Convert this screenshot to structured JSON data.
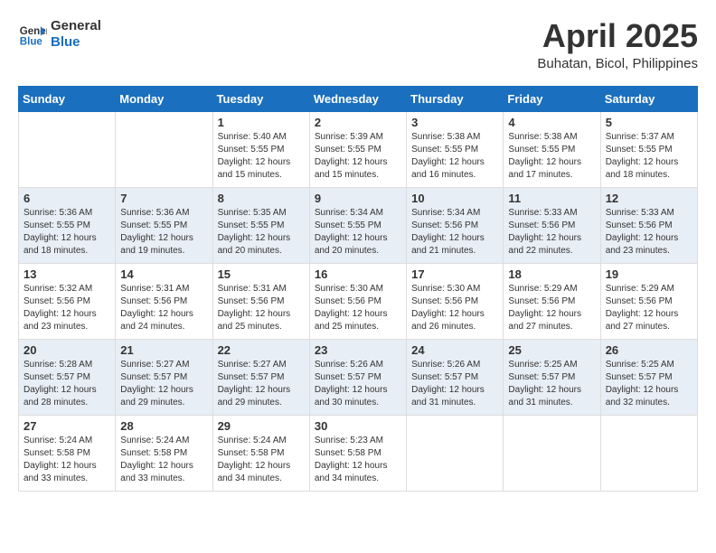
{
  "header": {
    "logo_line1": "General",
    "logo_line2": "Blue",
    "month_title": "April 2025",
    "location": "Buhatan, Bicol, Philippines"
  },
  "days_of_week": [
    "Sunday",
    "Monday",
    "Tuesday",
    "Wednesday",
    "Thursday",
    "Friday",
    "Saturday"
  ],
  "weeks": [
    [
      {
        "num": "",
        "info": ""
      },
      {
        "num": "",
        "info": ""
      },
      {
        "num": "1",
        "info": "Sunrise: 5:40 AM\nSunset: 5:55 PM\nDaylight: 12 hours and 15 minutes."
      },
      {
        "num": "2",
        "info": "Sunrise: 5:39 AM\nSunset: 5:55 PM\nDaylight: 12 hours and 15 minutes."
      },
      {
        "num": "3",
        "info": "Sunrise: 5:38 AM\nSunset: 5:55 PM\nDaylight: 12 hours and 16 minutes."
      },
      {
        "num": "4",
        "info": "Sunrise: 5:38 AM\nSunset: 5:55 PM\nDaylight: 12 hours and 17 minutes."
      },
      {
        "num": "5",
        "info": "Sunrise: 5:37 AM\nSunset: 5:55 PM\nDaylight: 12 hours and 18 minutes."
      }
    ],
    [
      {
        "num": "6",
        "info": "Sunrise: 5:36 AM\nSunset: 5:55 PM\nDaylight: 12 hours and 18 minutes."
      },
      {
        "num": "7",
        "info": "Sunrise: 5:36 AM\nSunset: 5:55 PM\nDaylight: 12 hours and 19 minutes."
      },
      {
        "num": "8",
        "info": "Sunrise: 5:35 AM\nSunset: 5:55 PM\nDaylight: 12 hours and 20 minutes."
      },
      {
        "num": "9",
        "info": "Sunrise: 5:34 AM\nSunset: 5:55 PM\nDaylight: 12 hours and 20 minutes."
      },
      {
        "num": "10",
        "info": "Sunrise: 5:34 AM\nSunset: 5:56 PM\nDaylight: 12 hours and 21 minutes."
      },
      {
        "num": "11",
        "info": "Sunrise: 5:33 AM\nSunset: 5:56 PM\nDaylight: 12 hours and 22 minutes."
      },
      {
        "num": "12",
        "info": "Sunrise: 5:33 AM\nSunset: 5:56 PM\nDaylight: 12 hours and 23 minutes."
      }
    ],
    [
      {
        "num": "13",
        "info": "Sunrise: 5:32 AM\nSunset: 5:56 PM\nDaylight: 12 hours and 23 minutes."
      },
      {
        "num": "14",
        "info": "Sunrise: 5:31 AM\nSunset: 5:56 PM\nDaylight: 12 hours and 24 minutes."
      },
      {
        "num": "15",
        "info": "Sunrise: 5:31 AM\nSunset: 5:56 PM\nDaylight: 12 hours and 25 minutes."
      },
      {
        "num": "16",
        "info": "Sunrise: 5:30 AM\nSunset: 5:56 PM\nDaylight: 12 hours and 25 minutes."
      },
      {
        "num": "17",
        "info": "Sunrise: 5:30 AM\nSunset: 5:56 PM\nDaylight: 12 hours and 26 minutes."
      },
      {
        "num": "18",
        "info": "Sunrise: 5:29 AM\nSunset: 5:56 PM\nDaylight: 12 hours and 27 minutes."
      },
      {
        "num": "19",
        "info": "Sunrise: 5:29 AM\nSunset: 5:56 PM\nDaylight: 12 hours and 27 minutes."
      }
    ],
    [
      {
        "num": "20",
        "info": "Sunrise: 5:28 AM\nSunset: 5:57 PM\nDaylight: 12 hours and 28 minutes."
      },
      {
        "num": "21",
        "info": "Sunrise: 5:27 AM\nSunset: 5:57 PM\nDaylight: 12 hours and 29 minutes."
      },
      {
        "num": "22",
        "info": "Sunrise: 5:27 AM\nSunset: 5:57 PM\nDaylight: 12 hours and 29 minutes."
      },
      {
        "num": "23",
        "info": "Sunrise: 5:26 AM\nSunset: 5:57 PM\nDaylight: 12 hours and 30 minutes."
      },
      {
        "num": "24",
        "info": "Sunrise: 5:26 AM\nSunset: 5:57 PM\nDaylight: 12 hours and 31 minutes."
      },
      {
        "num": "25",
        "info": "Sunrise: 5:25 AM\nSunset: 5:57 PM\nDaylight: 12 hours and 31 minutes."
      },
      {
        "num": "26",
        "info": "Sunrise: 5:25 AM\nSunset: 5:57 PM\nDaylight: 12 hours and 32 minutes."
      }
    ],
    [
      {
        "num": "27",
        "info": "Sunrise: 5:24 AM\nSunset: 5:58 PM\nDaylight: 12 hours and 33 minutes."
      },
      {
        "num": "28",
        "info": "Sunrise: 5:24 AM\nSunset: 5:58 PM\nDaylight: 12 hours and 33 minutes."
      },
      {
        "num": "29",
        "info": "Sunrise: 5:24 AM\nSunset: 5:58 PM\nDaylight: 12 hours and 34 minutes."
      },
      {
        "num": "30",
        "info": "Sunrise: 5:23 AM\nSunset: 5:58 PM\nDaylight: 12 hours and 34 minutes."
      },
      {
        "num": "",
        "info": ""
      },
      {
        "num": "",
        "info": ""
      },
      {
        "num": "",
        "info": ""
      }
    ]
  ]
}
